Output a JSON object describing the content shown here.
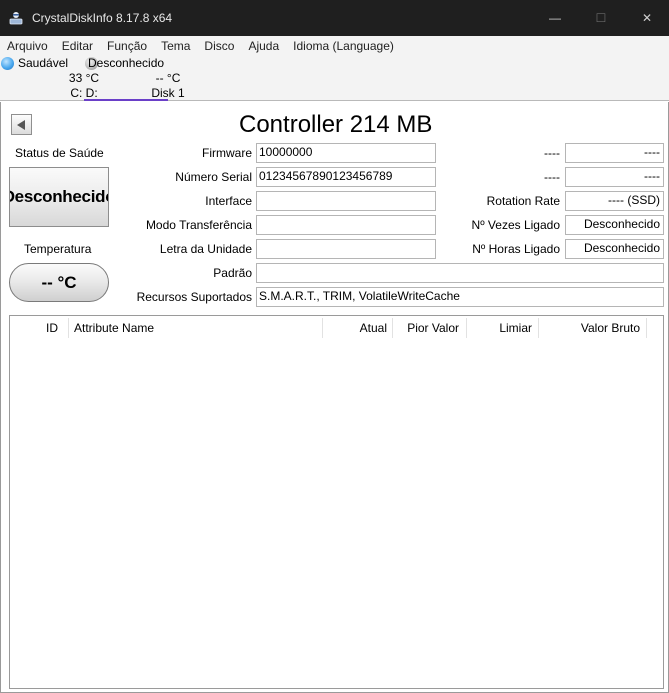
{
  "window": {
    "title": "CrystalDiskInfo 8.17.8 x64",
    "min_glyph": "—",
    "max_glyph": "☐",
    "close_glyph": "✕"
  },
  "menu": [
    "Arquivo",
    "Editar",
    "Função",
    "Tema",
    "Disco",
    "Ajuda",
    "Idioma (Language)"
  ],
  "disk_tabs": [
    {
      "status": "Saudável",
      "temp": "33 °C",
      "label": "C: D:",
      "status_color": "#4aa8ee"
    },
    {
      "status": "Desconhecido",
      "temp": "-- °C",
      "label": "Disk 1",
      "status_color": "#b8b8b8",
      "selected": true
    }
  ],
  "disk": {
    "title": "Controller 214 MB",
    "health_label": "Status de Saúde",
    "health_value": "Desconhecido",
    "temperature_label": "Temperatura",
    "temperature_value": "-- °C"
  },
  "fields": {
    "firmware": {
      "label": "Firmware",
      "value": "10000000"
    },
    "serial": {
      "label": "Número Serial",
      "value": "01234567890123456789"
    },
    "interface": {
      "label": "Interface",
      "value": ""
    },
    "transfer_mode": {
      "label": "Modo Transferência",
      "value": ""
    },
    "drive_letter": {
      "label": "Letra da Unidade",
      "value": ""
    },
    "standard": {
      "label": "Padrão",
      "value": ""
    },
    "features": {
      "label": "Recursos Suportados",
      "value": "S.M.A.R.T., TRIM, VolatileWriteCache"
    }
  },
  "right_fields": {
    "r1": {
      "label": "----",
      "value": "----"
    },
    "r2": {
      "label": "----",
      "value": "----"
    },
    "rotation": {
      "label": "Rotation Rate",
      "value": "---- (SSD)"
    },
    "power_on_count": {
      "label": "Nº Vezes Ligado",
      "value": "Desconhecido"
    },
    "power_on_hours": {
      "label": "Nº Horas Ligado",
      "value": "Desconhecido"
    }
  },
  "smart_table": {
    "columns": [
      "ID",
      "Attribute Name",
      "Atual",
      "Pior Valor",
      "Limiar",
      "Valor Bruto"
    ],
    "rows": []
  },
  "colors": {
    "accent": "#6a3fc8",
    "titlebar": "#1f1f1f",
    "healthy": "#4aa8ee",
    "unknown": "#b8b8b8"
  }
}
